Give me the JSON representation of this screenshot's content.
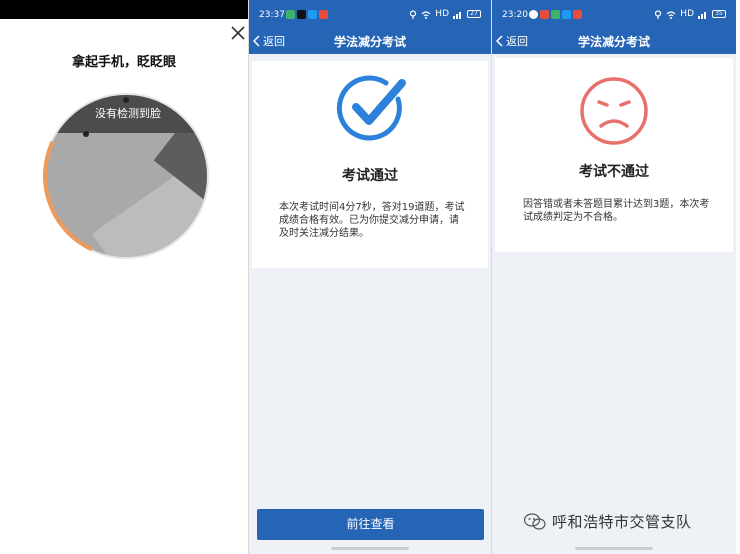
{
  "face_check": {
    "prompt": "拿起手机，眨眨眼",
    "camera_overlay": "没有检测到脸",
    "close_icon": "close-icon"
  },
  "pass_screen": {
    "status_time": "23:37",
    "network": "HD",
    "battery": "27",
    "back_label": "返回",
    "title": "学法减分考试",
    "result_title": "考试通过",
    "result_message": "本次考试时间4分7秒，答对19道题，考试成绩合格有效。已为你提交减分申请，请及时关注减分结果。",
    "button_label": "前往查看",
    "icon": "check-circle-icon",
    "accent": "#2664b6"
  },
  "fail_screen": {
    "status_time": "23:20",
    "network": "HD",
    "battery": "35",
    "back_label": "返回",
    "title": "学法减分考试",
    "result_title": "考试不通过",
    "result_message": "因答错或者未答题目累计达到3题，本次考试成绩判定为不合格。",
    "icon": "sad-face-icon",
    "icon_color": "#e8706c"
  },
  "watermark": {
    "text": "呼和浩特市交管支队",
    "icon": "wechat-icon"
  }
}
